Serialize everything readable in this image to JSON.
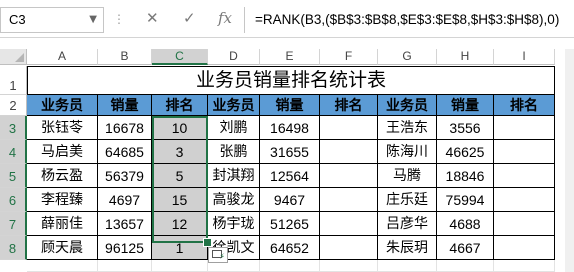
{
  "formula_bar": {
    "name_box": "C3",
    "cancel_icon": "✕",
    "enter_icon": "✓",
    "fx_label": "fx",
    "formula": "=RANK(B3,($B$3:$B$8,$E$3:$E$8,$H$3:$H$8),0)"
  },
  "columns": [
    "A",
    "B",
    "C",
    "D",
    "E",
    "F",
    "G",
    "H",
    "I"
  ],
  "rows": [
    "1",
    "2",
    "3",
    "4",
    "5",
    "6",
    "7",
    "8"
  ],
  "sheet": {
    "title": "业务员销量排名统计表",
    "headers": [
      "业务员",
      "销量",
      "排名",
      "业务员",
      "销量",
      "排名",
      "业务员",
      "销量",
      "排名"
    ],
    "data": [
      [
        "张钰苓",
        "16678",
        "10",
        "刘鹏",
        "16498",
        "",
        "王浩东",
        "3556",
        ""
      ],
      [
        "马启美",
        "64685",
        "3",
        "张鹏",
        "31655",
        "",
        "陈海川",
        "46625",
        ""
      ],
      [
        "杨云盈",
        "56379",
        "5",
        "封淇翔",
        "12564",
        "",
        "马腾",
        "18846",
        ""
      ],
      [
        "李程臻",
        "4697",
        "15",
        "高骏龙",
        "9467",
        "",
        "庄乐廷",
        "75994",
        ""
      ],
      [
        "薛丽佳",
        "13657",
        "12",
        "杨宇珑",
        "51265",
        "",
        "吕彦华",
        "4688",
        ""
      ],
      [
        "顾天晨",
        "96125",
        "1",
        "徐凯文",
        "64652",
        "",
        "朱辰玥",
        "4667",
        ""
      ]
    ]
  },
  "selection": {
    "active_cell": "C3",
    "range": "C3:C8",
    "accent_color": "#217346"
  },
  "colors": {
    "header_fill": "#5b9bd5",
    "rank_fill": "#d0d0d0"
  }
}
